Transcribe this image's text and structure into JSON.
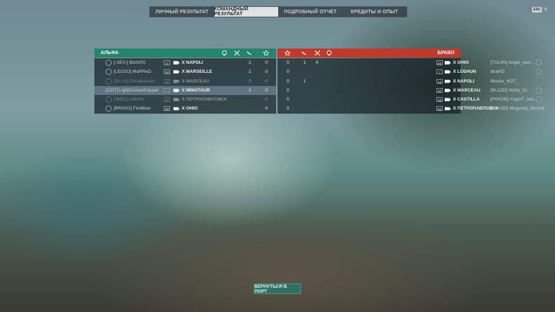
{
  "tabs": [
    {
      "label": "ЛИЧНЫЙ РЕЗУЛЬТАТ",
      "active": false
    },
    {
      "label": "КОМАНДНЫЙ РЕЗУЛЬТАТ",
      "active": true
    },
    {
      "label": "ПОДРОБНЫЙ ОТЧЁТ",
      "active": false
    },
    {
      "label": "КРЕДИТЫ И ОПЫТ",
      "active": false
    }
  ],
  "corner": {
    "esc_label": "ESC",
    "close_glyph": "✕"
  },
  "colors": {
    "ally": "#25856c",
    "enemy": "#c0392b",
    "accent_button": "#2f6f64"
  },
  "alpha": {
    "title": "АЛЬФА",
    "header_icons": [
      "skull-icon",
      "crossed-swords-icon",
      "plane-icon",
      "star-icon"
    ],
    "rows": [
      {
        "player": "[-SEV-] BishiGS",
        "tier": "8",
        "ship": "X NAPOLI",
        "col1": "1",
        "col2": "0",
        "highlight": false,
        "dim": false
      },
      {
        "player": "[LEG1O] MaRReD",
        "tier": "28",
        "ship": "X MARSEILLE",
        "col1": "1",
        "col2": "0",
        "highlight": false,
        "dim": false
      },
      {
        "player": "[SL-01] DimaBashkir",
        "tier": "26",
        "ship": "X MARCEAU",
        "col1": "3",
        "col2": "0",
        "highlight": false,
        "dim": true
      },
      {
        "player": "[1337] LightCruiserEnjoyer",
        "tier": "",
        "ship": "X MINOTAUR",
        "col1": "1",
        "col2": "0",
        "highlight": true,
        "dim": false
      },
      {
        "player": "[4MEZ] valkdol",
        "tier": "31",
        "ship": "X ПЕТРОПАВЛОВСК",
        "col1": "",
        "col2": "0",
        "highlight": false,
        "dim": true
      },
      {
        "player": "[BRAVO] FireBlow",
        "tier": "28",
        "ship": "X OHIO",
        "col1": "",
        "col2": "0",
        "highlight": false,
        "dim": false
      }
    ]
  },
  "bravo": {
    "title": "БРАВО",
    "header_icons": [
      "star-icon",
      "plane-icon",
      "crossed-swords-icon",
      "skull-icon"
    ],
    "rows": [
      {
        "c1": "0",
        "c2": "1",
        "c3": "4",
        "tier": "26",
        "ship": "X OHIO",
        "player": "[TOLPA] Angel_exor...",
        "dim": false
      },
      {
        "c1": "0",
        "c2": "",
        "c3": "",
        "tier": "7",
        "ship": "X LÜSHUN",
        "player": "lbraHD",
        "dim": false
      },
      {
        "c1": "0",
        "c2": "1",
        "c3": "",
        "tier": "18",
        "ship": "X NAPOLI",
        "player": "Master_KOT_",
        "dim": false
      },
      {
        "c1": "0",
        "c2": "",
        "c3": "",
        "tier": "30",
        "ship": "X MARCEAU",
        "player": "[BLAZD] Wolfy_81",
        "dim": false
      },
      {
        "c1": "0",
        "c2": "",
        "c3": "",
        "tier": "19",
        "ship": "X CASTILLA",
        "player": "[PVKGB] YsgorT_bez...",
        "dim": false
      },
      {
        "c1": "0",
        "c2": "",
        "c3": "",
        "tier": "34",
        "ship": "X ПЕТРОПАВЛОВСК",
        "player": "[ZAVOD] Moguchij_Okorok",
        "dim": false
      }
    ]
  },
  "port_button": {
    "label": "ВЕРНУТЬСЯ В ПОРТ"
  }
}
